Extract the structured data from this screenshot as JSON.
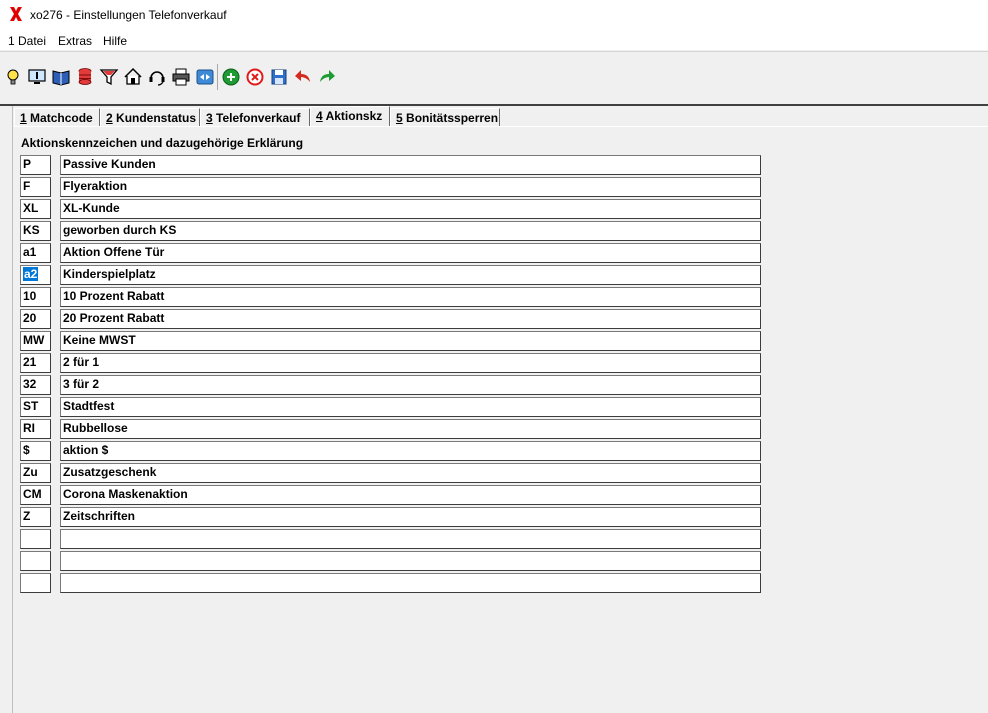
{
  "window": {
    "title": "xo276 - Einstellungen Telefonverkauf"
  },
  "menu": [
    "1 Datei",
    "Extras",
    "Hilfe"
  ],
  "toolbar": {
    "buttons": [
      "lightbulb-icon",
      "info-monitor-icon",
      "book-icon",
      "database-icon",
      "filter-icon",
      "home-icon",
      "headset-icon",
      "printer-icon",
      "exchange-icon",
      "add-icon",
      "cancel-icon",
      "save-icon",
      "undo-icon",
      "redo-icon"
    ]
  },
  "tabs": [
    {
      "num": "1",
      "label": " Matchcode"
    },
    {
      "num": "2",
      "label": " Kundenstatus"
    },
    {
      "num": "3",
      "label": " Telefonverkauf"
    },
    {
      "num": "4",
      "label": " Aktionskz"
    },
    {
      "num": "5",
      "label": " Bonitätssperren"
    }
  ],
  "active_tab": "4",
  "section": {
    "label": "Aktionskennzeichen und dazugehörige Erklärung"
  },
  "rows": [
    {
      "code": "P",
      "desc": "Passive Kunden"
    },
    {
      "code": "F",
      "desc": "Flyeraktion"
    },
    {
      "code": "XL",
      "desc": "XL-Kunde"
    },
    {
      "code": "KS",
      "desc": "geworben durch KS"
    },
    {
      "code": "a1",
      "desc": "Aktion Offene Tür"
    },
    {
      "code": "a2",
      "desc": "Kinderspielplatz"
    },
    {
      "code": "10",
      "desc": "10 Prozent Rabatt"
    },
    {
      "code": "20",
      "desc": "20 Prozent Rabatt"
    },
    {
      "code": "MW",
      "desc": "Keine MWST"
    },
    {
      "code": "21",
      "desc": "2 für 1"
    },
    {
      "code": "32",
      "desc": "3 für 2"
    },
    {
      "code": "ST",
      "desc": "Stadtfest"
    },
    {
      "code": "RI",
      "desc": "Rubbellose"
    },
    {
      "code": "$",
      "desc": "aktion $"
    },
    {
      "code": "Zu",
      "desc": "Zusatzgeschenk"
    },
    {
      "code": "CM",
      "desc": "Corona Maskenaktion"
    },
    {
      "code": "Z",
      "desc": "Zeitschriften"
    },
    {
      "code": "",
      "desc": ""
    },
    {
      "code": "",
      "desc": ""
    },
    {
      "code": "",
      "desc": ""
    }
  ],
  "selected_row_code": "a2",
  "colors": {
    "logo": "#e00000",
    "selection": "#0078d7"
  }
}
